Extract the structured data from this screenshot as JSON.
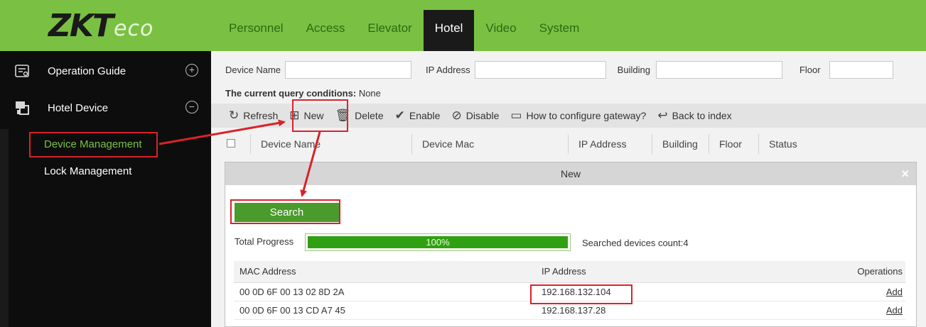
{
  "header": {
    "logo_text": "ZKTeco",
    "nav": [
      {
        "label": "Personnel",
        "active": false
      },
      {
        "label": "Access",
        "active": false
      },
      {
        "label": "Elevator",
        "active": false
      },
      {
        "label": "Hotel",
        "active": true
      },
      {
        "label": "Video",
        "active": false
      },
      {
        "label": "System",
        "active": false
      }
    ]
  },
  "sidebar": {
    "menus": [
      {
        "label": "Operation Guide",
        "icon": "guide-icon",
        "toggle": "+"
      },
      {
        "label": "Hotel Device",
        "icon": "device-icon",
        "toggle": "−"
      }
    ],
    "items": [
      {
        "label": "Device Management",
        "active": true
      },
      {
        "label": "Lock Management",
        "active": false
      }
    ]
  },
  "query": {
    "fields": [
      {
        "label": "Device Name",
        "value": ""
      },
      {
        "label": "IP Address",
        "value": ""
      },
      {
        "label": "Building",
        "value": ""
      },
      {
        "label": "Floor",
        "value": ""
      }
    ],
    "conditions_label": "The current query conditions:",
    "conditions_value": "None"
  },
  "toolbar": {
    "refresh": "Refresh",
    "new": "New",
    "delete": "Delete",
    "enable": "Enable",
    "disable": "Disable",
    "gateway": "How to configure gateway?",
    "back": "Back to index"
  },
  "table": {
    "columns": [
      "Device Name",
      "Device Mac",
      "IP Address",
      "Building",
      "Floor",
      "Status"
    ]
  },
  "modal": {
    "title": "New",
    "close": "×",
    "search_button": "Search",
    "progress_label": "Total Progress",
    "progress_text": "100%",
    "progress_value": 1.0,
    "count_label": "Searched devices count:4",
    "columns": [
      "MAC Address",
      "IP Address",
      "Operations"
    ],
    "rows": [
      {
        "mac": "00 0D 6F 00 13 02 8D 2A",
        "ip": "192.168.132.104",
        "op": "Add"
      },
      {
        "mac": "00 0D 6F 00 13 CD A7 45",
        "ip": "192.168.137.28",
        "op": "Add"
      }
    ]
  },
  "colors": {
    "brand_green": "#7ac143",
    "highlight_red": "#d9222a",
    "progress_green": "#2fa012"
  }
}
